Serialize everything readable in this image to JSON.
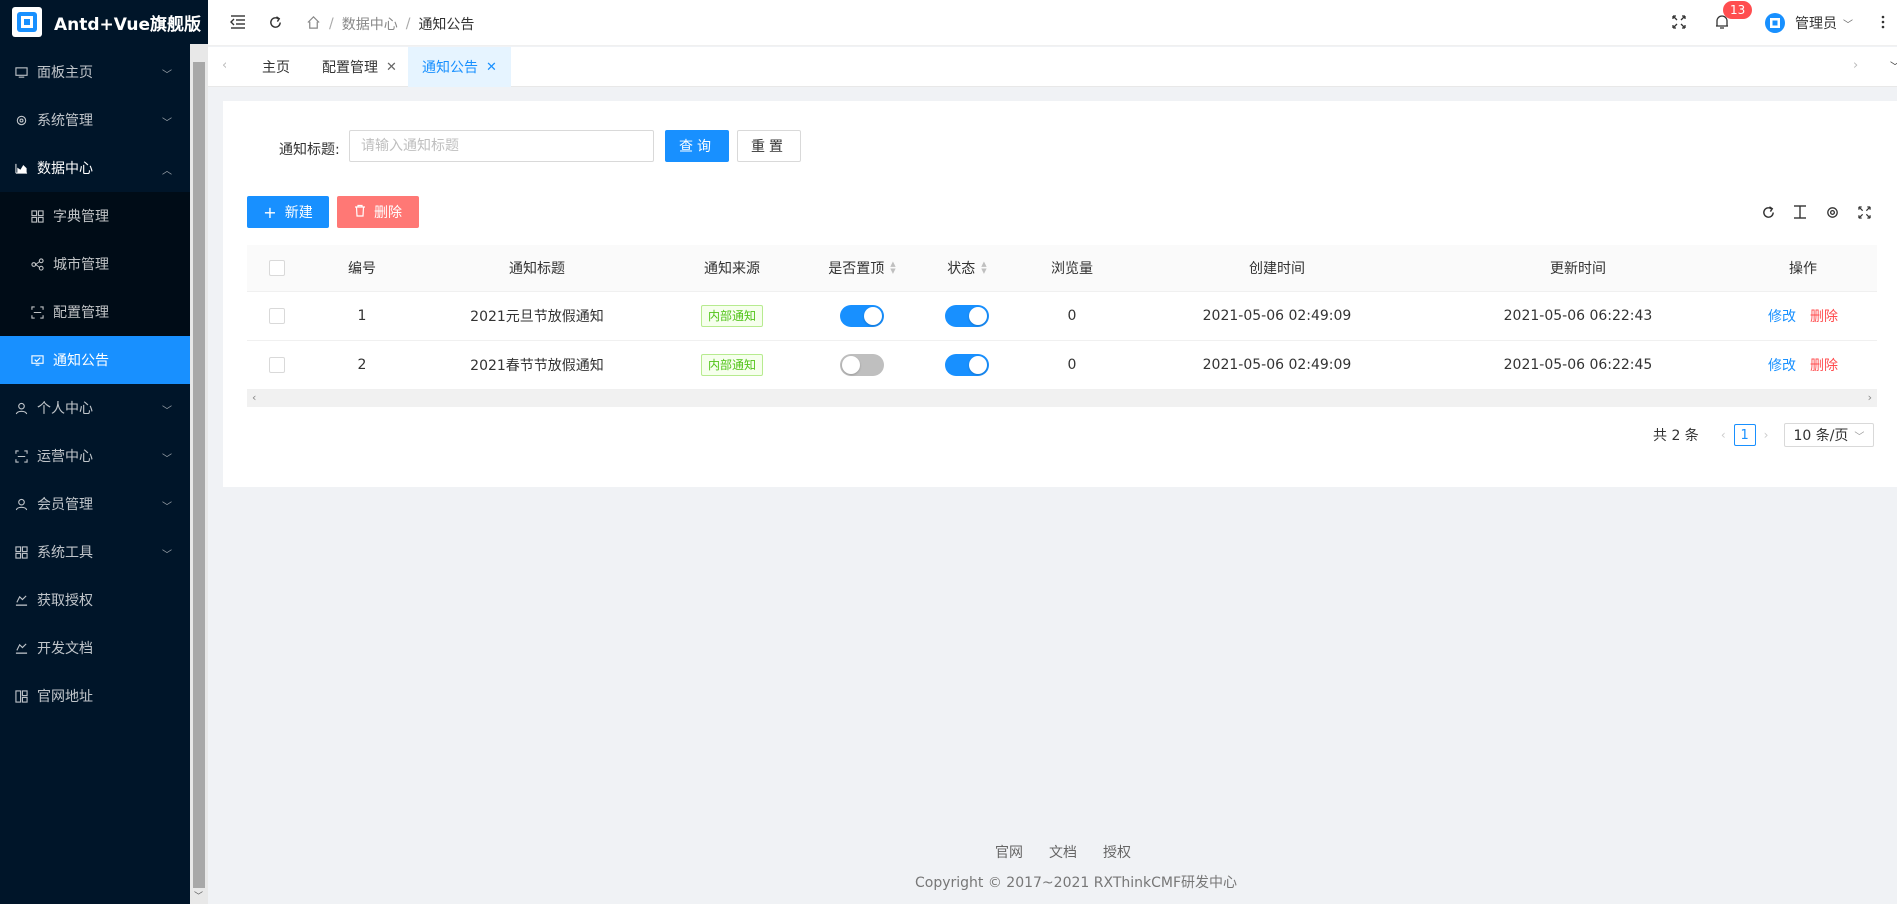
{
  "app": {
    "title": "Antd+Vue旗舰版"
  },
  "sidebar": {
    "items": [
      {
        "label": "面板主页",
        "icon": "monitor-icon",
        "expandable": true
      },
      {
        "label": "系统管理",
        "icon": "gear-icon",
        "expandable": true
      },
      {
        "label": "数据中心",
        "icon": "area-chart-icon",
        "expandable": true,
        "open": true
      },
      {
        "label": "字典管理",
        "icon": "dictionary-icon",
        "sub": true
      },
      {
        "label": "城市管理",
        "icon": "cluster-icon",
        "sub": true
      },
      {
        "label": "配置管理",
        "icon": "scan-icon",
        "sub": true
      },
      {
        "label": "通知公告",
        "icon": "notification-icon",
        "sub": true,
        "active": true
      },
      {
        "label": "个人中心",
        "icon": "user-icon",
        "expandable": true
      },
      {
        "label": "运营中心",
        "icon": "scan-icon",
        "expandable": true
      },
      {
        "label": "会员管理",
        "icon": "user-icon",
        "expandable": true
      },
      {
        "label": "系统工具",
        "icon": "tools-icon",
        "expandable": true
      },
      {
        "label": "获取授权",
        "icon": "license-icon"
      },
      {
        "label": "开发文档",
        "icon": "document-icon"
      },
      {
        "label": "官网地址",
        "icon": "website-icon"
      }
    ]
  },
  "header": {
    "breadcrumb": [
      "数据中心",
      "通知公告"
    ],
    "notification_count": "13",
    "user_name": "管理员"
  },
  "tabs": [
    {
      "label": "主页",
      "closable": false
    },
    {
      "label": "配置管理",
      "closable": true
    },
    {
      "label": "通知公告",
      "closable": true,
      "active": true
    }
  ],
  "search": {
    "label": "通知标题:",
    "placeholder": "请输入通知标题",
    "value": "",
    "query_label": "查询",
    "reset_label": "重置"
  },
  "toolbar": {
    "new_label": "新建",
    "delete_label": "删除"
  },
  "table": {
    "columns": [
      "编号",
      "通知标题",
      "通知来源",
      "是否置顶",
      "状态",
      "浏览量",
      "创建时间",
      "更新时间",
      "操作"
    ],
    "rows": [
      {
        "id": "1",
        "title": "2021元旦节放假通知",
        "source": "内部通知",
        "pinned": true,
        "status": true,
        "views": "0",
        "created": "2021-05-06 02:49:09",
        "updated": "2021-05-06 06:22:43",
        "edit": "修改",
        "delete": "删除"
      },
      {
        "id": "2",
        "title": "2021春节节放假通知",
        "source": "内部通知",
        "pinned": false,
        "status": true,
        "views": "0",
        "created": "2021-05-06 02:49:09",
        "updated": "2021-05-06 06:22:45",
        "edit": "修改",
        "delete": "删除"
      }
    ]
  },
  "pagination": {
    "total_text": "共 2 条",
    "current_page": "1",
    "page_size": "10 条/页"
  },
  "footer": {
    "links": [
      "官网",
      "文档",
      "授权"
    ],
    "copyright": "Copyright © 2017~2021 RXThinkCMF研发中心"
  },
  "colors": {
    "sidebar_bg": "#001529",
    "primary": "#1890ff",
    "danger": "#ff7875",
    "success": "#52c41a"
  }
}
